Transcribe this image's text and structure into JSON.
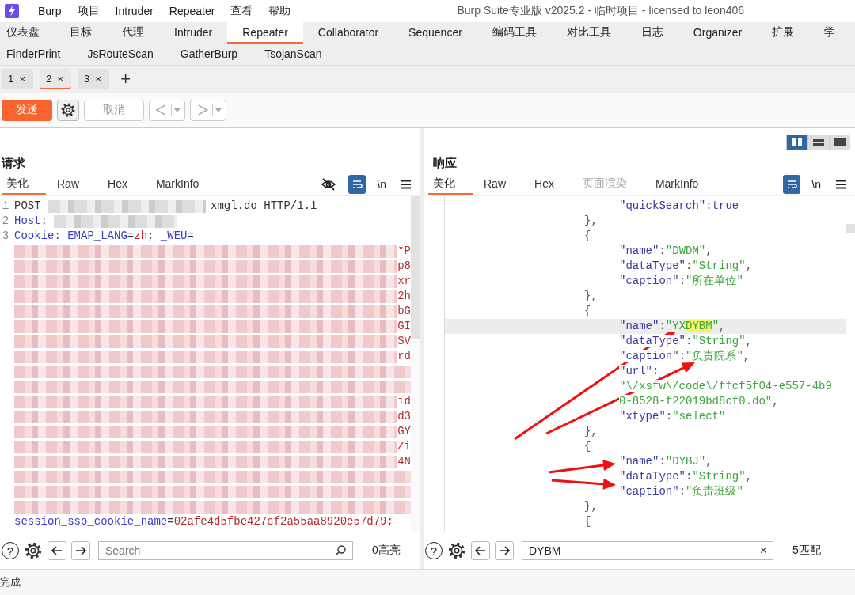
{
  "window": {
    "title": "Burp Suite专业版  v2025.2 - 临时项目 - licensed to leon406"
  },
  "menu": [
    "Burp",
    "项目",
    "Intruder",
    "Repeater",
    "查看",
    "帮助"
  ],
  "main_tabs": [
    {
      "label": "仪表盘",
      "selected": false
    },
    {
      "label": "目标",
      "selected": false
    },
    {
      "label": "代理",
      "selected": false
    },
    {
      "label": "Intruder",
      "selected": false
    },
    {
      "label": "Repeater",
      "selected": true
    },
    {
      "label": "Collaborator",
      "selected": false
    },
    {
      "label": "Sequencer",
      "selected": false
    },
    {
      "label": "编码工具",
      "selected": false
    },
    {
      "label": "对比工具",
      "selected": false
    },
    {
      "label": "日志",
      "selected": false
    },
    {
      "label": "Organizer",
      "selected": false
    },
    {
      "label": "扩展",
      "selected": false
    },
    {
      "label": "学",
      "selected": false
    }
  ],
  "extension_tabs": [
    {
      "label": "FinderPrint",
      "selected": false
    },
    {
      "label": "JsRouteScan",
      "selected": false
    },
    {
      "label": "GatherBurp",
      "selected": false
    },
    {
      "label": "TsojanScan",
      "selected": false
    }
  ],
  "repeater_tabs": [
    {
      "label": "1",
      "close": "×",
      "selected": false
    },
    {
      "label": "2",
      "close": "×",
      "selected": true
    },
    {
      "label": "3",
      "close": "×",
      "selected": false
    }
  ],
  "new_tab": "+",
  "toolbar": {
    "send": "发送",
    "cancel": {
      "label": "取消",
      "disabled": true
    },
    "history": [
      {
        "kind": "back",
        "disabled": true
      },
      {
        "kind": "forward",
        "disabled": true
      }
    ]
  },
  "request": {
    "title": "请求",
    "tabs": [
      {
        "label": "美化",
        "selected": true,
        "disabled": false
      },
      {
        "label": "Raw",
        "selected": false,
        "disabled": false
      },
      {
        "label": "Hex",
        "selected": false,
        "disabled": false
      },
      {
        "label": "MarkInfo",
        "selected": false,
        "disabled": false
      }
    ],
    "tools": [
      {
        "kind": "hide",
        "active": false
      },
      {
        "kind": "wrap",
        "active": true
      },
      {
        "kind": "newline",
        "label": "\\n",
        "active": false
      },
      {
        "kind": "menu",
        "active": false
      }
    ],
    "lines": [
      {
        "number": "1",
        "tokens": [
          {
            "kind": "text",
            "text": "POST "
          },
          {
            "kind": "mask-short"
          },
          {
            "kind": "text",
            "text": "xmgl.do HTTP/1.1"
          }
        ]
      },
      {
        "number": "2",
        "tokens": [
          {
            "kind": "header",
            "text": "Host: "
          },
          {
            "kind": "mask-host"
          }
        ]
      },
      {
        "number": "3",
        "tokens": [
          {
            "kind": "header",
            "text": "Cookie: EMAP_LANG"
          },
          {
            "kind": "text",
            "text": "="
          },
          {
            "kind": "value",
            "text": "zh"
          },
          {
            "kind": "text",
            "text": "; "
          },
          {
            "kind": "header",
            "text": "_WEU"
          },
          {
            "kind": "text",
            "text": "="
          }
        ]
      },
      {
        "tokens": [
          {
            "kind": "mask-fill"
          },
          {
            "kind": "value",
            "text": "*P"
          }
        ]
      },
      {
        "tokens": [
          {
            "kind": "mask-fill"
          },
          {
            "kind": "value",
            "text": "p8"
          }
        ]
      },
      {
        "tokens": [
          {
            "kind": "mask-fill"
          },
          {
            "kind": "value",
            "text": "xr"
          }
        ]
      },
      {
        "tokens": [
          {
            "kind": "mask-fill"
          },
          {
            "kind": "value",
            "text": "2h"
          }
        ]
      },
      {
        "tokens": [
          {
            "kind": "mask-fill"
          },
          {
            "kind": "value",
            "text": "bG"
          }
        ]
      },
      {
        "tokens": [
          {
            "kind": "mask-fill"
          },
          {
            "kind": "value",
            "text": "GI"
          }
        ]
      },
      {
        "tokens": [
          {
            "kind": "mask-fill"
          },
          {
            "kind": "value",
            "text": "SV"
          }
        ]
      },
      {
        "tokens": [
          {
            "kind": "mask-fill"
          },
          {
            "kind": "value",
            "text": "rd"
          }
        ]
      },
      {
        "tokens": [
          {
            "kind": "mask-fill"
          }
        ]
      },
      {
        "tokens": [
          {
            "kind": "mask-fill"
          }
        ]
      },
      {
        "tokens": [
          {
            "kind": "mask-fill"
          },
          {
            "kind": "value",
            "text": "id"
          }
        ]
      },
      {
        "tokens": [
          {
            "kind": "mask-fill"
          },
          {
            "kind": "value",
            "text": "d3"
          }
        ]
      },
      {
        "tokens": [
          {
            "kind": "mask-fill"
          },
          {
            "kind": "value",
            "text": "GY"
          }
        ]
      },
      {
        "tokens": [
          {
            "kind": "mask-fill"
          },
          {
            "kind": "value",
            "text": "Zi"
          }
        ]
      },
      {
        "tokens": [
          {
            "kind": "mask-fill"
          },
          {
            "kind": "value",
            "text": "4N"
          }
        ]
      },
      {
        "tokens": [
          {
            "kind": "mask-fill"
          }
        ]
      },
      {
        "tokens": [
          {
            "kind": "mask-fill"
          }
        ]
      },
      {
        "tokens": [
          {
            "kind": "mask-fill"
          }
        ]
      },
      {
        "tokens": [
          {
            "kind": "header",
            "text": "session_sso_cookie_name"
          },
          {
            "kind": "text",
            "text": "="
          },
          {
            "kind": "value",
            "text": "02afe4d5fbe427cf2a55aa8920e57d79;"
          }
        ]
      }
    ],
    "help": "?",
    "search": {
      "placeholder": "Search"
    },
    "count": "0高亮"
  },
  "response": {
    "layout_buttons": [
      {
        "kind": "columns",
        "selected": true
      },
      {
        "kind": "rows",
        "selected": false
      },
      {
        "kind": "single",
        "selected": false
      }
    ],
    "title": "响应",
    "tabs": [
      {
        "label": "美化",
        "selected": true,
        "disabled": false
      },
      {
        "label": "Raw",
        "selected": false,
        "disabled": false
      },
      {
        "label": "Hex",
        "selected": false,
        "disabled": false
      },
      {
        "label": "页面渲染",
        "selected": false,
        "disabled": true
      },
      {
        "label": "MarkInfo",
        "selected": false,
        "disabled": false
      }
    ],
    "tools": [
      {
        "kind": "wrap",
        "active": true
      },
      {
        "kind": "newline",
        "label": "\\n",
        "active": false
      },
      {
        "kind": "menu",
        "active": false
      }
    ],
    "lines": [
      {
        "kind": "field",
        "current": false,
        "tokens": [
          {
            "kind": "key",
            "text": "\"quickSearch\""
          },
          {
            "kind": "punct",
            "text": ":"
          },
          {
            "kind": "literal",
            "text": "true"
          }
        ]
      },
      {
        "kind": "brace",
        "current": false,
        "tokens": [
          {
            "kind": "punct",
            "text": "},"
          }
        ]
      },
      {
        "kind": "brace",
        "current": false,
        "tokens": [
          {
            "kind": "punct",
            "text": "{"
          }
        ]
      },
      {
        "kind": "field",
        "current": false,
        "tokens": [
          {
            "kind": "key",
            "text": "\"name\""
          },
          {
            "kind": "punct",
            "text": ":"
          },
          {
            "kind": "string",
            "text": "\"DWDM\""
          },
          {
            "kind": "punct",
            "text": ","
          }
        ]
      },
      {
        "kind": "field",
        "current": false,
        "tokens": [
          {
            "kind": "key",
            "text": "\"dataType\""
          },
          {
            "kind": "punct",
            "text": ":"
          },
          {
            "kind": "string",
            "text": "\"String\""
          },
          {
            "kind": "punct",
            "text": ","
          }
        ]
      },
      {
        "kind": "field",
        "current": false,
        "tokens": [
          {
            "kind": "key",
            "text": "\"caption\""
          },
          {
            "kind": "punct",
            "text": ":"
          },
          {
            "kind": "string",
            "text": "\"所在单位\""
          }
        ]
      },
      {
        "kind": "brace",
        "current": false,
        "tokens": [
          {
            "kind": "punct",
            "text": "},"
          }
        ]
      },
      {
        "kind": "brace",
        "current": false,
        "tokens": [
          {
            "kind": "punct",
            "text": "{"
          }
        ]
      },
      {
        "kind": "field",
        "current": true,
        "tokens": [
          {
            "kind": "key",
            "text": "\"name\""
          },
          {
            "kind": "punct",
            "text": ":"
          },
          {
            "kind": "string",
            "text": "\"YX"
          },
          {
            "kind": "string",
            "text": "DYBM",
            "match": true
          },
          {
            "kind": "string",
            "text": "\""
          },
          {
            "kind": "punct",
            "text": ","
          }
        ]
      },
      {
        "kind": "field",
        "current": false,
        "tokens": [
          {
            "kind": "key",
            "text": "\"dataType\""
          },
          {
            "kind": "punct",
            "text": ":"
          },
          {
            "kind": "string",
            "text": "\"String\""
          },
          {
            "kind": "punct",
            "text": ","
          }
        ]
      },
      {
        "kind": "field",
        "current": false,
        "tokens": [
          {
            "kind": "key",
            "text": "\"caption\""
          },
          {
            "kind": "punct",
            "text": ":"
          },
          {
            "kind": "string",
            "text": "\"负责院系\""
          },
          {
            "kind": "punct",
            "text": ","
          }
        ]
      },
      {
        "kind": "field",
        "current": false,
        "tokens": [
          {
            "kind": "key",
            "text": "\"url\""
          },
          {
            "kind": "punct",
            "text": ":"
          }
        ]
      },
      {
        "kind": "field",
        "current": false,
        "tokens": [
          {
            "kind": "string",
            "text": "\"\\/xsfw\\/code\\/ffcf5f04-e557-4b9"
          }
        ]
      },
      {
        "kind": "field",
        "current": false,
        "tokens": [
          {
            "kind": "string",
            "text": "0-8528-f22019bd8cf0.do\""
          },
          {
            "kind": "punct",
            "text": ","
          }
        ]
      },
      {
        "kind": "field",
        "current": false,
        "tokens": [
          {
            "kind": "key",
            "text": "\"xtype\""
          },
          {
            "kind": "punct",
            "text": ":"
          },
          {
            "kind": "string",
            "text": "\"select\""
          }
        ]
      },
      {
        "kind": "brace",
        "current": false,
        "tokens": [
          {
            "kind": "punct",
            "text": "},"
          }
        ]
      },
      {
        "kind": "brace",
        "current": false,
        "tokens": [
          {
            "kind": "punct",
            "text": "{"
          }
        ]
      },
      {
        "kind": "field",
        "current": false,
        "tokens": [
          {
            "kind": "key",
            "text": "\"name\""
          },
          {
            "kind": "punct",
            "text": ":"
          },
          {
            "kind": "string",
            "text": "\"DYBJ\""
          },
          {
            "kind": "punct",
            "text": ","
          }
        ]
      },
      {
        "kind": "field",
        "current": false,
        "tokens": [
          {
            "kind": "key",
            "text": "\"dataType\""
          },
          {
            "kind": "punct",
            "text": ":"
          },
          {
            "kind": "string",
            "text": "\"String\""
          },
          {
            "kind": "punct",
            "text": ","
          }
        ]
      },
      {
        "kind": "field",
        "current": false,
        "tokens": [
          {
            "kind": "key",
            "text": "\"caption\""
          },
          {
            "kind": "punct",
            "text": ":"
          },
          {
            "kind": "string",
            "text": "\"负责班级\""
          }
        ]
      },
      {
        "kind": "brace",
        "current": false,
        "tokens": [
          {
            "kind": "punct",
            "text": "},"
          }
        ]
      },
      {
        "kind": "brace",
        "current": false,
        "tokens": [
          {
            "kind": "punct",
            "text": "{"
          }
        ]
      }
    ],
    "help": "?",
    "search": {
      "value": "DYBM",
      "clear": "×"
    },
    "count": "5匹配"
  },
  "status_bar": "完成"
}
